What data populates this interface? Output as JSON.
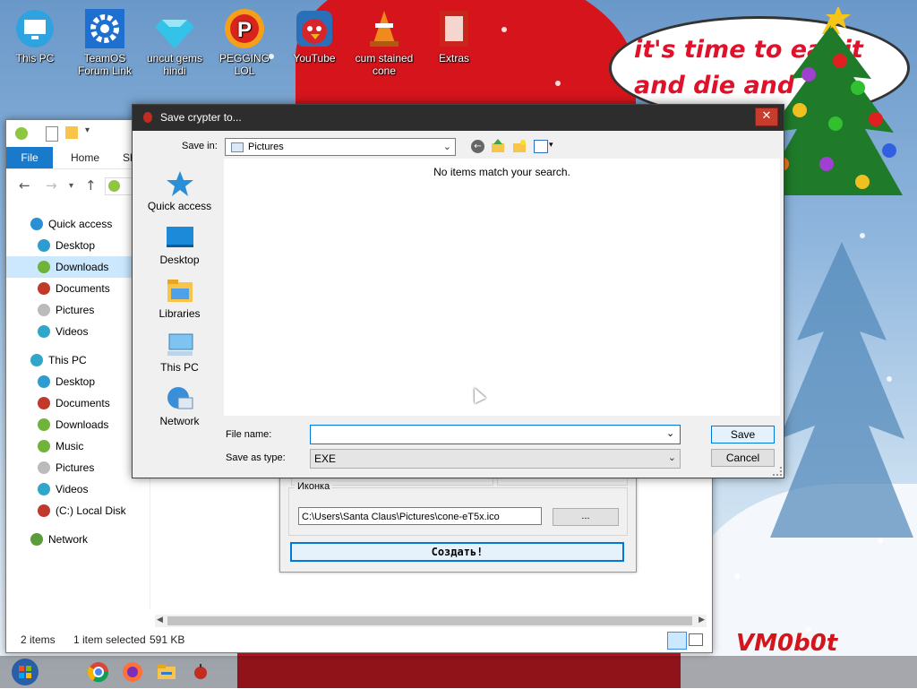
{
  "desktop": {
    "icons": [
      {
        "label": "This PC"
      },
      {
        "label": "TeamOS\nForum Link"
      },
      {
        "label": "uncut gems\nhindi"
      },
      {
        "label": "PEGGING LOL"
      },
      {
        "label": "YouTube"
      },
      {
        "label": "cum stained\ncone"
      },
      {
        "label": "Extras"
      }
    ],
    "speech": "it's time to eat it and die and d",
    "signature": "VM0b0t"
  },
  "explorer": {
    "ribbon_tabs": {
      "file": "File",
      "home": "Home",
      "share": "Sh"
    },
    "sidebar": [
      {
        "label": "Quick access",
        "icon": "star-icon",
        "color": "#2b8fd6"
      },
      {
        "label": "Desktop",
        "icon": "desktop-icon",
        "color": "#2f9cd1"
      },
      {
        "label": "Downloads",
        "icon": "downloads-icon",
        "color": "#6fb33b"
      },
      {
        "label": "Documents",
        "icon": "documents-icon",
        "color": "#c0392b"
      },
      {
        "label": "Pictures",
        "icon": "pictures-icon",
        "color": "#bbbbbb"
      },
      {
        "label": "Videos",
        "icon": "videos-icon",
        "color": "#30a7c9"
      },
      {
        "label": "This PC",
        "icon": "pc-icon",
        "color": "#30a7c9"
      },
      {
        "label": "Desktop",
        "icon": "desktop-icon",
        "color": "#2f9cd1"
      },
      {
        "label": "Documents",
        "icon": "documents-icon",
        "color": "#c0392b"
      },
      {
        "label": "Downloads",
        "icon": "downloads-icon",
        "color": "#6fb33b"
      },
      {
        "label": "Music",
        "icon": "music-icon",
        "color": "#6fb33b"
      },
      {
        "label": "Pictures",
        "icon": "pictures-icon",
        "color": "#bbbbbb"
      },
      {
        "label": "Videos",
        "icon": "videos-icon",
        "color": "#30a7c9"
      },
      {
        "label": "(C:) Local Disk",
        "icon": "disk-icon",
        "color": "#c0392b"
      },
      {
        "label": "Network",
        "icon": "network-icon",
        "color": "#5a9b3a"
      }
    ],
    "status": {
      "items": "2 items",
      "selected": "1 item selected",
      "size": "591 KB"
    }
  },
  "crypter": {
    "icon_group": "Иконка",
    "icon_path": "C:\\Users\\Santa Claus\\Pictures\\cone-eT5x.ico",
    "browse": "...",
    "create": "Создать!"
  },
  "dialog": {
    "title": "Save crypter to...",
    "close": "✕",
    "save_in_label": "Save in:",
    "save_in_value": "Pictures",
    "places": [
      {
        "label": "Quick access"
      },
      {
        "label": "Desktop"
      },
      {
        "label": "Libraries"
      },
      {
        "label": "This PC"
      },
      {
        "label": "Network"
      }
    ],
    "empty_message": "No items match your search.",
    "file_name_label": "File name:",
    "file_name_value": "",
    "save_type_label": "Save as type:",
    "save_type_value": "EXE",
    "save_button": "Save",
    "cancel_button": "Cancel"
  }
}
